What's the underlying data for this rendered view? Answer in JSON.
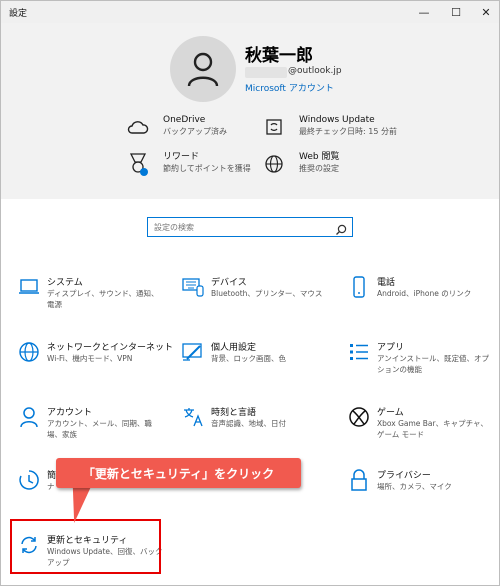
{
  "window": {
    "title": "設定",
    "min_icon": "—",
    "max_icon": "☐",
    "close_icon": "✕"
  },
  "account": {
    "name": "秋葉一郎",
    "email_suffix": "@outlook.jp",
    "link": "Microsoft アカウント"
  },
  "quick_settings": [
    {
      "icon": "cloud-icon",
      "title": "OneDrive",
      "desc": "バックアップ済み"
    },
    {
      "icon": "sync-icon",
      "title": "Windows Update",
      "desc": "最終チェック日時: 15 分前"
    },
    {
      "icon": "rewards-icon",
      "title": "リワード",
      "desc": "節約してポイントを獲得"
    },
    {
      "icon": "globe-icon",
      "title": "Web 閲覧",
      "desc": "推奨の設定"
    }
  ],
  "search": {
    "placeholder": "設定の検索"
  },
  "categories": [
    {
      "icon": "laptop-icon",
      "title": "システム",
      "desc": "ディスプレイ、サウンド、通知、電源"
    },
    {
      "icon": "keyboard-icon",
      "title": "デバイス",
      "desc": "Bluetooth、プリンター、マウス"
    },
    {
      "icon": "phone-icon",
      "title": "電話",
      "desc": "Android、iPhone のリンク"
    },
    {
      "icon": "globe-icon",
      "title": "ネットワークとインターネット",
      "desc": "Wi-Fi、機内モード、VPN"
    },
    {
      "icon": "paintbrush-icon",
      "title": "個人用設定",
      "desc": "背景、ロック画面、色"
    },
    {
      "icon": "apps-icon",
      "title": "アプリ",
      "desc": "アンインストール、既定値、オプションの機能"
    },
    {
      "icon": "person-icon",
      "title": "アカウント",
      "desc": "アカウント、メール、同期、職場、家族"
    },
    {
      "icon": "time-language-icon",
      "title": "時刻と言語",
      "desc": "音声認識、地域、日付"
    },
    {
      "icon": "xbox-icon",
      "title": "ゲーム",
      "desc": "Xbox Game Bar、キャプチャ、ゲーム モード"
    },
    {
      "icon": "ease-of-access-icon",
      "title": "簡",
      "desc": "ナ"
    },
    {
      "icon": "lock-icon",
      "title": "プライバシー",
      "desc": "場所、カメラ、マイク"
    },
    {
      "icon": "update-icon",
      "title": "更新とセキュリティ",
      "desc": "Windows Update、回復、バックアップ"
    }
  ],
  "annotation": {
    "callout": "「更新とセキュリティ」をクリック"
  },
  "colors": {
    "accent": "#0078d7",
    "callout": "#f15a4f",
    "highlight": "#e60000"
  }
}
